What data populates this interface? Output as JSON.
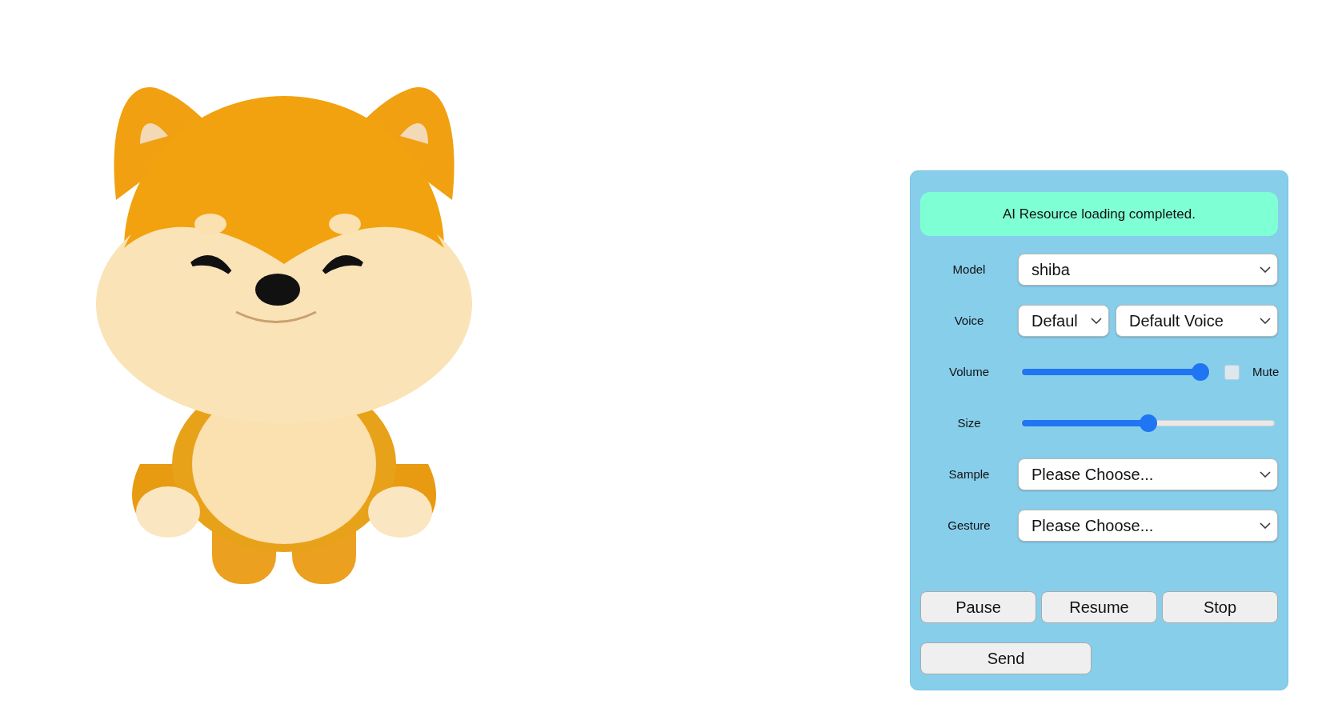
{
  "status": {
    "text": "AI Resource loading completed."
  },
  "fields": [
    {
      "kind": "select",
      "label": "Model",
      "values": [
        "shiba"
      ]
    },
    {
      "kind": "select",
      "label": "Voice",
      "values": [
        "Defaul",
        "Default Voice"
      ]
    },
    {
      "kind": "slider",
      "label": "Volume",
      "level": 0.95,
      "checkbox": {
        "label": "Mute",
        "checked": false
      }
    },
    {
      "kind": "slider",
      "label": "Size",
      "level": 0.5
    },
    {
      "kind": "select",
      "label": "Sample",
      "values": [
        "Please Choose..."
      ]
    },
    {
      "kind": "select",
      "label": "Gesture",
      "values": [
        "Please Choose..."
      ]
    }
  ],
  "buttons": [
    "Pause",
    "Resume",
    "Stop"
  ],
  "send_button": "Send"
}
